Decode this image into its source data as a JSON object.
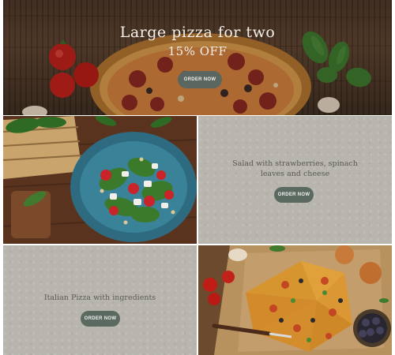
{
  "hero": {
    "title": "Large pizza for two",
    "subtitle": "15% OFF",
    "button_label": "ORDER NOW"
  },
  "tiles": {
    "salad": {
      "caption": "Salad with strawberries, spinach leaves and cheese",
      "button_label": "ORDER NOW"
    },
    "pizza": {
      "caption": "Italian Pizza with ingredients",
      "button_label": "ORDER NOW"
    }
  },
  "colors": {
    "button_bg": "#5b6a61",
    "panel_bg": "#b8b5ae",
    "caption_text": "#5c5a56"
  }
}
